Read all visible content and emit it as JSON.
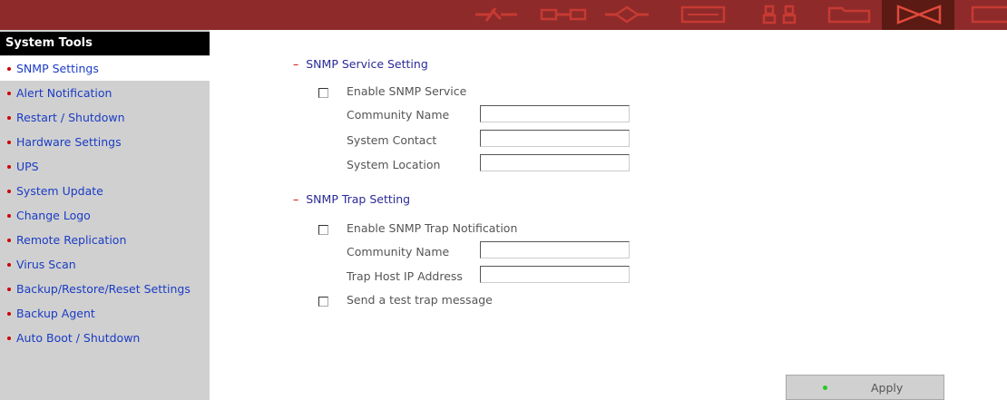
{
  "accent_color": "#8e2a2a",
  "toolbar_icons": [
    {
      "name": "network-icon"
    },
    {
      "name": "device-icon"
    },
    {
      "name": "share-icon"
    },
    {
      "name": "monitor-icon"
    },
    {
      "name": "users-icon"
    },
    {
      "name": "folder-icon"
    },
    {
      "name": "system-tools-icon",
      "active": true
    },
    {
      "name": "logs-icon"
    }
  ],
  "sidebar": {
    "title": "System Tools",
    "items": [
      {
        "label": "SNMP Settings",
        "active": true
      },
      {
        "label": "Alert Notification"
      },
      {
        "label": "Restart / Shutdown"
      },
      {
        "label": "Hardware Settings"
      },
      {
        "label": "UPS"
      },
      {
        "label": "System Update"
      },
      {
        "label": "Change Logo"
      },
      {
        "label": "Remote Replication"
      },
      {
        "label": "Virus Scan"
      },
      {
        "label": "Backup/Restore/Reset Settings"
      },
      {
        "label": "Backup Agent"
      },
      {
        "label": "Auto Boot / Shutdown"
      }
    ]
  },
  "snmp_service": {
    "title": "SNMP Service Setting",
    "enable_label": "Enable SNMP Service",
    "enable_checked": false,
    "community_label": "Community Name",
    "community_value": "",
    "contact_label": "System Contact",
    "contact_value": "",
    "location_label": "System Location",
    "location_value": ""
  },
  "snmp_trap": {
    "title": "SNMP Trap Setting",
    "enable_label": "Enable SNMP Trap Notification",
    "enable_checked": false,
    "community_label": "Community Name",
    "community_value": "",
    "host_label": "Trap Host IP Address",
    "host_value": "",
    "test_label": "Send a test trap message",
    "test_checked": false
  },
  "apply_label": "Apply"
}
